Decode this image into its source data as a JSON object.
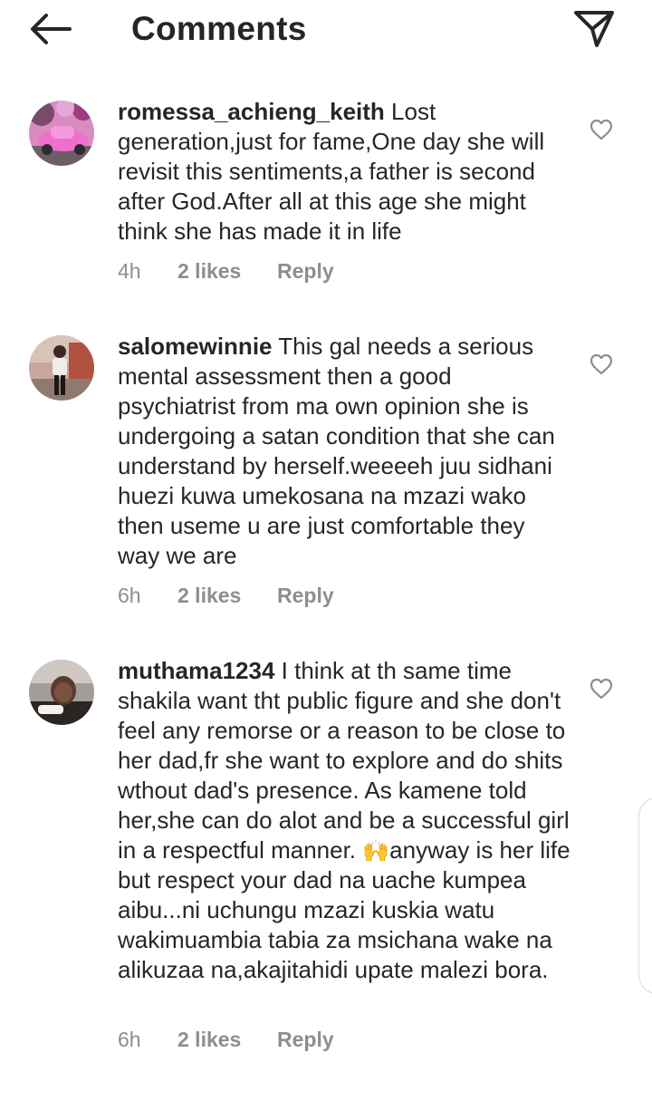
{
  "header": {
    "title": "Comments",
    "back_icon": "arrow-left-icon",
    "send_icon": "paper-plane-icon"
  },
  "comments": [
    {
      "username": "romessa_achieng_keith",
      "text": "Lost generation,just for fame,One day she will revisit this sentiments,a father is second after God.After all at this age she might think she has made it in life",
      "time": "4h",
      "likes": "2 likes",
      "reply": "Reply"
    },
    {
      "username": "salomewinnie",
      "text": "This gal needs a serious mental assessment then a good psychiatrist  from ma own opinion she is undergoing a satan condition that she can understand by herself.weeeeh juu sidhani huezi kuwa umekosana na mzazi wako then useme u are just comfortable they way we are",
      "time": "6h",
      "likes": "2 likes",
      "reply": "Reply"
    },
    {
      "username": "muthama1234",
      "text": "I think at th same time shakila want tht public figure and she don't feel any remorse or a reason to be close to her dad,fr she want to explore and do shits wthout dad's presence. As kamene told her,she can do alot and be a successful girl in a respectful manner.",
      "emoji": "🙌",
      "text2": "anyway is her life but respect your dad na uache kumpea aibu...ni uchungu mzazi kuskia watu wakimuambia tabia za msichana wake na alikuzaa na,akajitahidi upate malezi bora.",
      "time": "6h",
      "likes": "2 likes",
      "reply": "Reply"
    }
  ],
  "colors": {
    "text": "#262626",
    "secondary": "#8e8e8e",
    "background": "#ffffff"
  }
}
